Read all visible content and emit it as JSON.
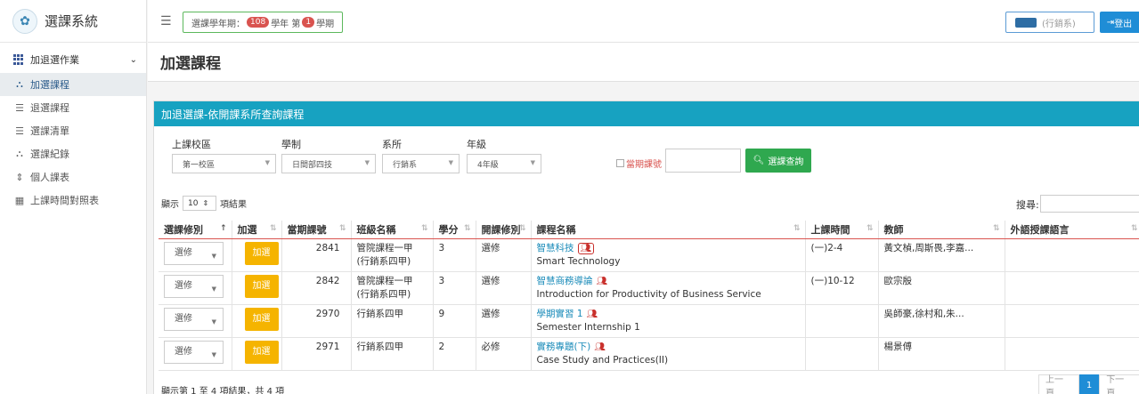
{
  "app": {
    "title": "選課系統"
  },
  "sidebar": {
    "section_label": "加退選作業",
    "items": [
      {
        "label": "加選課程",
        "icon": "sitemap-icon"
      },
      {
        "label": "退選課程",
        "icon": "list-icon"
      },
      {
        "label": "選課清單",
        "icon": "list-icon"
      },
      {
        "label": "選課紀錄",
        "icon": "sitemap-icon"
      },
      {
        "label": "個人課表",
        "icon": "sort-icon"
      },
      {
        "label": "上課時間對照表",
        "icon": "table-icon"
      }
    ]
  },
  "topbar": {
    "term_prefix": "選課學年期：",
    "year": "108",
    "year_suffix": "學年 第",
    "semester": "1",
    "semester_suffix": "學期",
    "user_dept": "(行銷系)",
    "logout_label": "登出"
  },
  "page": {
    "title": "加選課程"
  },
  "panel": {
    "title": "加退選課-依開課系所查詢課程"
  },
  "filters": {
    "campus": {
      "label": "上課校區",
      "value": "第一校區"
    },
    "system": {
      "label": "學制",
      "value": "日間部四技"
    },
    "dept": {
      "label": "系所",
      "value": "行銷系"
    },
    "grade": {
      "label": "年級",
      "value": "4年級"
    },
    "course_no_checkbox": "當期課號",
    "query_button": "選課查詢"
  },
  "table_controls": {
    "show_prefix": "顯示",
    "page_size": "10",
    "show_suffix": "項結果",
    "search_label": "搜尋:"
  },
  "table": {
    "columns": [
      "選課修別",
      "加選",
      "當期課號",
      "班級名稱",
      "學分",
      "開課修別",
      "課程名稱",
      "上課時間",
      "教師",
      "外語授課語言"
    ],
    "rows": [
      {
        "select": "選修",
        "add": "加選",
        "no": "2841",
        "class": "管院課程一甲",
        "class2": "(行銷系四甲)",
        "credit": "3",
        "type": "選修",
        "cname": "智慧科技",
        "ename": "Smart Technology",
        "time": "(一)2-4",
        "teacher": "黃文楨,周斯畏,李嘉...",
        "lang": ""
      },
      {
        "select": "選修",
        "add": "加選",
        "no": "2842",
        "class": "管院課程一甲",
        "class2": "(行銷系四甲)",
        "credit": "3",
        "type": "選修",
        "cname": "智慧商務導論",
        "ename": "Introduction for Productivity of Business Service",
        "time": "(一)10-12",
        "teacher": "歐宗殷",
        "lang": ""
      },
      {
        "select": "選修",
        "add": "加選",
        "no": "2970",
        "class": "行銷系四甲",
        "class2": "",
        "credit": "9",
        "type": "選修",
        "cname": "學期實習 1",
        "ename": "Semester Internship 1",
        "time": "",
        "teacher": "吳師豪,徐村和,朱...",
        "lang": ""
      },
      {
        "select": "選修",
        "add": "加選",
        "no": "2971",
        "class": "行銷系四甲",
        "class2": "",
        "credit": "2",
        "type": "必修",
        "cname": "實務專題(下)",
        "ename": "Case Study and Practices(II)",
        "time": "",
        "teacher": "楊景傅",
        "lang": ""
      }
    ]
  },
  "footer": {
    "info": "顯示第 1 至 4 項結果，共 4 項",
    "prev": "上一頁",
    "page": "1",
    "next": "下一頁"
  },
  "colors": {
    "header": "#17a2c1",
    "query_button": "#2fa84f",
    "add_button": "#f5b400",
    "logout": "#1f8dd6",
    "badge": "#d9534f"
  }
}
